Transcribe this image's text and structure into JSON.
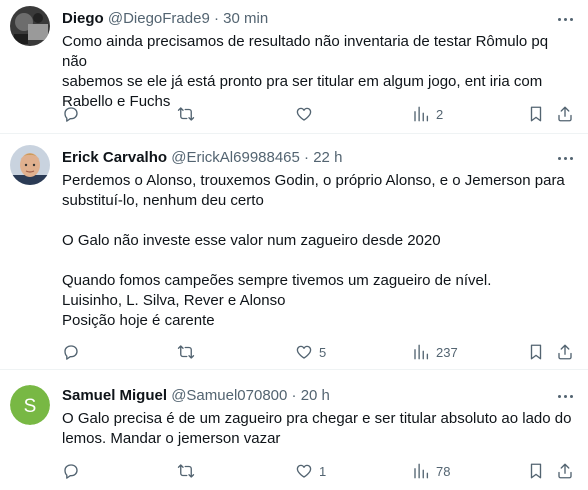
{
  "tweets": [
    {
      "name": "Diego",
      "handle": "@DiegoFrade9",
      "sep": "·",
      "time": "30 min",
      "lines": [
        "Como ainda precisamos de resultado não inventaria de testar Rômulo pq não",
        "sabemos se ele já está pronto pra ser titular em algum jogo, ent iria com",
        "Rabello e Fuchs"
      ],
      "replies": "",
      "retweets": "",
      "likes": "",
      "views": "2"
    },
    {
      "name": "Erick Carvalho",
      "handle": "@ErickAl69988465",
      "sep": "·",
      "time": "22 h",
      "lines": [
        "Perdemos o Alonso, trouxemos Godin, o próprio Alonso, e o Jemerson para",
        "substituí-lo, nenhum deu certo",
        "",
        "O Galo não investe esse valor num zagueiro desde 2020",
        "",
        "Quando fomos campeões sempre tivemos um zagueiro de nível.",
        "Luisinho, L. Silva, Rever e Alonso",
        "Posição hoje é carente"
      ],
      "replies": "",
      "retweets": "",
      "likes": "5",
      "views": "237"
    },
    {
      "name": "Samuel Miguel",
      "handle": "@Samuel070800",
      "sep": "·",
      "time": "20 h",
      "avatar_letter": "S",
      "lines": [
        "O Galo precisa é de um zagueiro pra chegar e ser titular absoluto ao lado do",
        "lemos. Mandar o jemerson vazar"
      ],
      "replies": "",
      "retweets": "",
      "likes": "1",
      "views": "78"
    }
  ],
  "colors": {
    "text": "#0f1419",
    "secondary": "#536471",
    "divider": "#eff3f4",
    "samuel_avatar": "#78b844"
  },
  "icons": [
    "reply-icon",
    "retweet-icon",
    "like-icon",
    "views-icon",
    "bookmark-icon",
    "share-icon",
    "more-icon"
  ]
}
